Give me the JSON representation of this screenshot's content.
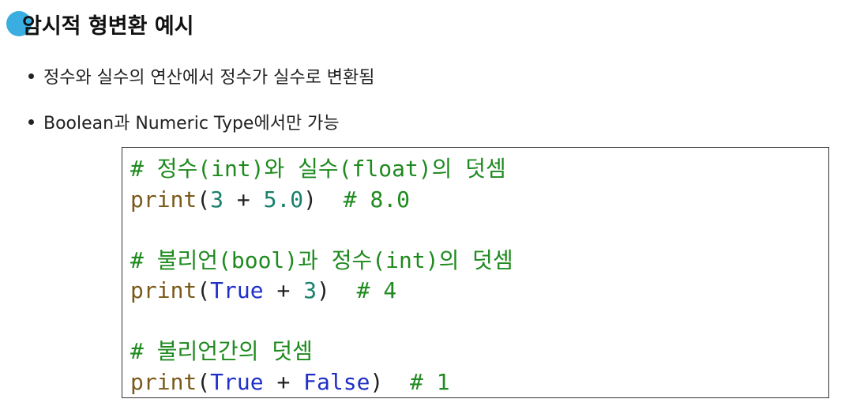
{
  "title": "암시적 형변환 예시",
  "bullets": [
    "정수와 실수의 연산에서 정수가 실수로 변환됨",
    "Boolean과 Numeric Type에서만 가능"
  ],
  "code": {
    "block1": {
      "comment": "# 정수(int)와 실수(float)의 덧셈",
      "func": "print",
      "open": "(",
      "arg1": "3",
      "op": " + ",
      "arg2": "5.0",
      "close": ")",
      "gap": "  ",
      "result_comment": "# 8.0"
    },
    "block2": {
      "comment": "# 불리언(bool)과 정수(int)의 덧셈",
      "func": "print",
      "open": "(",
      "arg1": "True",
      "op": " + ",
      "arg2": "3",
      "close": ")",
      "gap": "  ",
      "result_comment": "# 4"
    },
    "block3": {
      "comment": "# 불리언간의 덧셈",
      "func": "print",
      "open": "(",
      "arg1": "True",
      "op": " + ",
      "arg2": "False",
      "close": ")",
      "gap": "  ",
      "result_comment": "# 1"
    }
  },
  "colors": {
    "title_dot": "#3aaee0",
    "comment": "#1f8a1f",
    "builtin": "#7a5a1a",
    "number": "#18806b",
    "keyword": "#1f2fc8"
  }
}
